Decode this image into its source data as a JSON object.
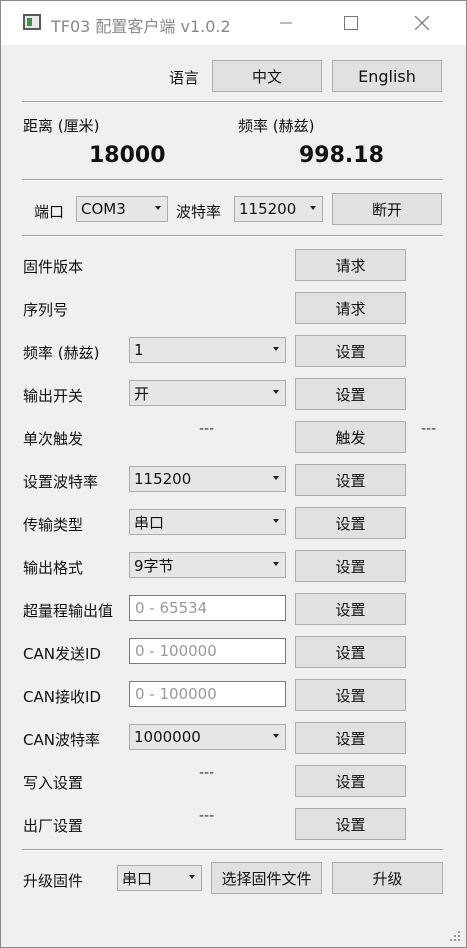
{
  "window": {
    "title": "TF03 配置客户端 v1.0.2"
  },
  "language": {
    "label": "语言",
    "chinese": "中文",
    "english": "English"
  },
  "readout": {
    "distance_label": "距离 (厘米)",
    "distance_value": "18000",
    "frequency_label": "频率 (赫兹)",
    "frequency_value": "998.18"
  },
  "port": {
    "label": "端口",
    "value": "COM3",
    "baud_label": "波特率",
    "baud_value": "115200",
    "disconnect": "断开"
  },
  "rows": {
    "fw_label": "固件版本",
    "fw_btn": "请求",
    "serial_label": "序列号",
    "serial_btn": "请求",
    "freq_label": "频率 (赫兹)",
    "freq_value": "1",
    "freq_btn": "设置",
    "output_label": "输出开关",
    "output_value": "开",
    "output_btn": "设置",
    "trigger_label": "单次触发",
    "trigger_dash_left": "---",
    "trigger_btn": "触发",
    "trigger_dash_right": "---",
    "setbaud_label": "设置波特率",
    "setbaud_value": "115200",
    "setbaud_btn": "设置",
    "transport_label": "传输类型",
    "transport_value": "串口",
    "transport_btn": "设置",
    "format_label": "输出格式",
    "format_value": "9字节",
    "format_btn": "设置",
    "overrange_label": "超量程输出值",
    "overrange_placeholder": "0 - 65534",
    "overrange_btn": "设置",
    "cansend_label": "CAN发送ID",
    "cansend_placeholder": "0 - 100000",
    "cansend_btn": "设置",
    "canrecv_label": "CAN接收ID",
    "canrecv_placeholder": "0 - 100000",
    "canrecv_btn": "设置",
    "canbaud_label": "CAN波特率",
    "canbaud_value": "1000000",
    "canbaud_btn": "设置",
    "save_label": "写入设置",
    "save_dash": "---",
    "save_btn": "设置",
    "factory_label": "出厂设置",
    "factory_dash": "---",
    "factory_btn": "设置"
  },
  "upgrade": {
    "label": "升级固件",
    "mode_value": "串口",
    "choose_file": "选择固件文件",
    "upgrade_btn": "升级"
  }
}
